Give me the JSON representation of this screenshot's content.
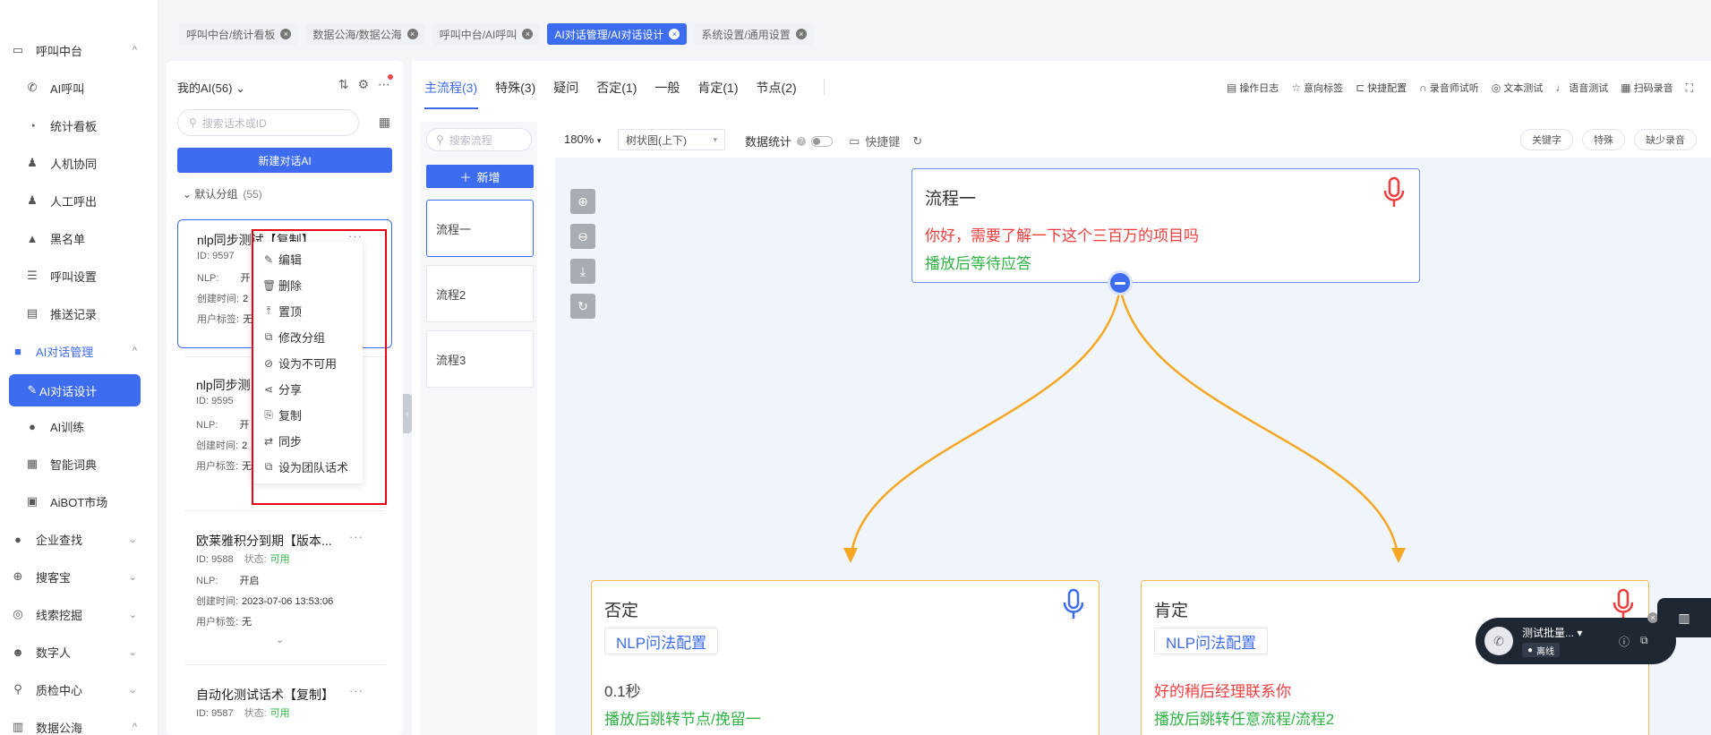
{
  "colors": {
    "primary": "#3d6cf0",
    "danger": "#f23c3c",
    "success": "#2fb344",
    "edge": "#f5a623"
  },
  "sidebar": {
    "items": [
      {
        "label": "呼叫中台",
        "icon": "monitor-icon",
        "arrow": "^"
      },
      {
        "label": "AI呼叫",
        "icon": "phone-icon"
      },
      {
        "label": "统计看板",
        "icon": "pie-chart-icon"
      },
      {
        "label": "人机协同",
        "icon": "user-icon"
      },
      {
        "label": "人工呼出",
        "icon": "user-out-icon"
      },
      {
        "label": "黑名单",
        "icon": "warning-icon"
      },
      {
        "label": "呼叫设置",
        "icon": "sliders-icon"
      },
      {
        "label": "推送记录",
        "icon": "doc-icon"
      },
      {
        "label": "AI对话管理",
        "icon": "book-icon",
        "arrow": "^"
      },
      {
        "label": "AI对话设计",
        "icon": "pen-icon"
      },
      {
        "label": "AI训练",
        "icon": "chat-icon"
      },
      {
        "label": "智能词典",
        "icon": "dict-icon"
      },
      {
        "label": "AiBOT市场",
        "icon": "store-icon"
      },
      {
        "label": "企业查找",
        "icon": "bulb-icon",
        "arrow": "v"
      },
      {
        "label": "搜客宝",
        "icon": "search-plus-icon",
        "arrow": "v"
      },
      {
        "label": "线索挖掘",
        "icon": "target-icon",
        "arrow": "v"
      },
      {
        "label": "数字人",
        "icon": "robot-icon",
        "arrow": "v"
      },
      {
        "label": "质检中心",
        "icon": "search-icon",
        "arrow": "v"
      },
      {
        "label": "数据公海",
        "icon": "db-icon",
        "arrow": "^"
      }
    ]
  },
  "topbar": {
    "tabs": [
      {
        "label": "呼叫中台/统计看板"
      },
      {
        "label": "数据公海/数据公海"
      },
      {
        "label": "呼叫中台/AI呼叫"
      },
      {
        "label": "AI对话管理/AI对话设计"
      },
      {
        "label": "系统设置/通用设置"
      }
    ]
  },
  "ai_panel": {
    "header": "我的AI(56)",
    "search_placeholder": "搜索话术或ID",
    "new_button": "新建对话AI",
    "group_label": "默认分组",
    "group_count": "(55)",
    "cards": [
      {
        "title": "nlp同步测试【复制】...",
        "id": "ID: 9597",
        "nlp_label": "NLP:",
        "nlp": "开",
        "created_label": "创建时间:",
        "created": "2",
        "tags_label": "用户标签:",
        "tags": "无"
      },
      {
        "title": "nlp同步测",
        "id": "ID: 9595",
        "nlp_label": "NLP:",
        "nlp": "开",
        "created_label": "创建时间:",
        "created": "2",
        "tags_label": "用户标签:",
        "tags": "无"
      },
      {
        "title": "欧莱雅积分到期【版本...",
        "id": "ID: 9588",
        "status_label": "状态:",
        "status": "可用",
        "nlp_label": "NLP:",
        "nlp": "开启",
        "created_label": "创建时间:",
        "created": "2023-07-06 13:53:06",
        "tags_label": "用户标签:",
        "tags": "无"
      },
      {
        "title": "自动化测试话术【复制】",
        "id": "ID: 9587",
        "status_label": "状态:",
        "status": "可用"
      }
    ]
  },
  "context_menu": {
    "items": [
      {
        "label": "编辑",
        "icon": "edit-icon"
      },
      {
        "label": "删除",
        "icon": "trash-icon"
      },
      {
        "label": "置顶",
        "icon": "pin-top-icon"
      },
      {
        "label": "修改分组",
        "icon": "group-icon"
      },
      {
        "label": "设为不可用",
        "icon": "disable-icon"
      },
      {
        "label": "分享",
        "icon": "share-icon"
      },
      {
        "label": "复制",
        "icon": "copy-icon"
      },
      {
        "label": "同步",
        "icon": "sync-icon"
      },
      {
        "label": "设为团队话术",
        "icon": "team-icon"
      }
    ]
  },
  "main": {
    "tabs": [
      {
        "label": "主流程(3)"
      },
      {
        "label": "特殊(3)"
      },
      {
        "label": "疑问"
      },
      {
        "label": "否定(1)"
      },
      {
        "label": "一般"
      },
      {
        "label": "肯定(1)"
      },
      {
        "label": "节点(2)"
      }
    ],
    "tools": [
      {
        "label": "操作日志",
        "icon": "log-icon"
      },
      {
        "label": "意向标签",
        "icon": "star-icon"
      },
      {
        "label": "快捷配置",
        "icon": "bookmark-icon"
      },
      {
        "label": "录音师试听",
        "icon": "headphone-icon"
      },
      {
        "label": "文本测试",
        "icon": "ai-text-icon"
      },
      {
        "label": "语音测试",
        "icon": "mic-icon"
      },
      {
        "label": "扫码录音",
        "icon": "qr-icon"
      }
    ]
  },
  "flow_list": {
    "search_placeholder": "搜索流程",
    "add_button": "新增",
    "items": [
      {
        "label": "流程一"
      },
      {
        "label": "流程2"
      },
      {
        "label": "流程3"
      }
    ]
  },
  "canvas": {
    "zoom": "180%",
    "view_mode": "树状图(上下)",
    "stats_label": "数据统计",
    "hotkey_label": "快捷键",
    "buttons": [
      {
        "label": "关键字"
      },
      {
        "label": "特殊"
      },
      {
        "label": "缺少录音"
      }
    ],
    "nodes": {
      "root": {
        "title": "流程一",
        "line1": "你好，需要了解一下这个三百万的项目吗",
        "line2": "播放后等待应答"
      },
      "left": {
        "title": "否定",
        "nlp": "NLP问法配置",
        "wait": "0.1秒",
        "line2": "播放后跳转节点/挽留一"
      },
      "right": {
        "title": "肯定",
        "nlp": "NLP问法配置",
        "line1": "好的稍后经理联系你",
        "line2": "播放后跳转任意流程/流程2"
      }
    }
  },
  "call_widget": {
    "name": "测试批量...",
    "status": "离线"
  }
}
